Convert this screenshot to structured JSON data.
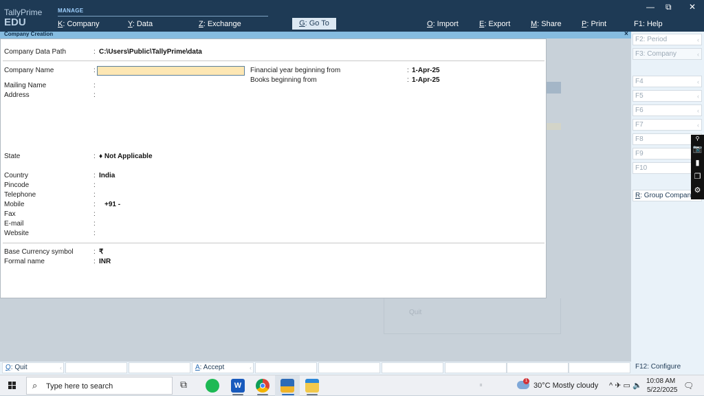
{
  "app": {
    "brand": "TallyPrime",
    "edition": "EDU",
    "section": "MANAGE"
  },
  "menu": [
    {
      "key": "K",
      "label": ": Company"
    },
    {
      "key": "Y",
      "label": ": Data"
    },
    {
      "key": "Z",
      "label": ": Exchange"
    },
    {
      "key": "G",
      "label": ": Go To"
    },
    {
      "key": "O",
      "label": ": Import"
    },
    {
      "key": "E",
      "label": ": Export"
    },
    {
      "key": "M",
      "label": ": Share"
    },
    {
      "key": "P",
      "label": ": Print"
    },
    {
      "key": "F1",
      "label": ": Help"
    }
  ],
  "window_controls": {
    "minimize": "—",
    "restore": "⧉",
    "close": "✕"
  },
  "panel": {
    "title": "Company  Creation",
    "close": "×",
    "data_path_label": "Company Data Path",
    "data_path_value": "C:\\Users\\Public\\TallyPrime\\data",
    "fields": {
      "company_name": {
        "label": "Company Name",
        "value": ""
      },
      "mailing_name": {
        "label": "Mailing Name",
        "value": ""
      },
      "address": {
        "label": "Address",
        "value": ""
      },
      "state": {
        "label": "State",
        "value": "♦ Not Applicable"
      },
      "country": {
        "label": "Country",
        "value": "India"
      },
      "pincode": {
        "label": "Pincode",
        "value": ""
      },
      "telephone": {
        "label": "Telephone",
        "value": ""
      },
      "mobile": {
        "label": "Mobile",
        "value": "+91  -"
      },
      "fax": {
        "label": "Fax",
        "value": ""
      },
      "email": {
        "label": "E-mail",
        "value": ""
      },
      "website": {
        "label": "Website",
        "value": ""
      },
      "base_currency": {
        "label": "Base Currency symbol",
        "value": "₹"
      },
      "formal_name": {
        "label": "Formal name",
        "value": "INR"
      }
    },
    "financial_year": {
      "label": "Financial year beginning from",
      "value": "1-Apr-25"
    },
    "books_beginning": {
      "label": "Books beginning from",
      "value": "1-Apr-25"
    },
    "colon": ":"
  },
  "background": {
    "quit": "Quit"
  },
  "right_panel": [
    {
      "label": "F2: Period",
      "active": false
    },
    {
      "label": "F3: Company",
      "active": false
    },
    {
      "label": "F4",
      "active": false
    },
    {
      "label": "F5",
      "active": false
    },
    {
      "label": "F6",
      "active": false
    },
    {
      "label": "F7",
      "active": false
    },
    {
      "label": "F8",
      "active": false
    },
    {
      "label": "F9",
      "active": false
    },
    {
      "label": "F10",
      "active": false
    },
    {
      "label": "Group Company",
      "key": "R",
      "active": true
    }
  ],
  "bottom_bar": {
    "quit": {
      "key": "Q",
      "label": ": Quit"
    },
    "accept": {
      "key": "A",
      "label": ": Accept"
    },
    "configure": {
      "key": "F12",
      "label": ": Configure"
    }
  },
  "taskbar": {
    "search_placeholder": "Type here to search",
    "weather": "30°C  Mostly cloudy",
    "weather_badge": "1",
    "tray": "^  ✈ ▭  🔈",
    "time": "10:08 AM",
    "date": "5/22/2025",
    "word_letter": "W",
    "faint_icon": "⏸"
  },
  "colors": {
    "topbar": "#1e3a55",
    "panel_title": "#86bce0",
    "input_highlight": "#fde7b4",
    "side_panel": "#e9f2f9"
  }
}
